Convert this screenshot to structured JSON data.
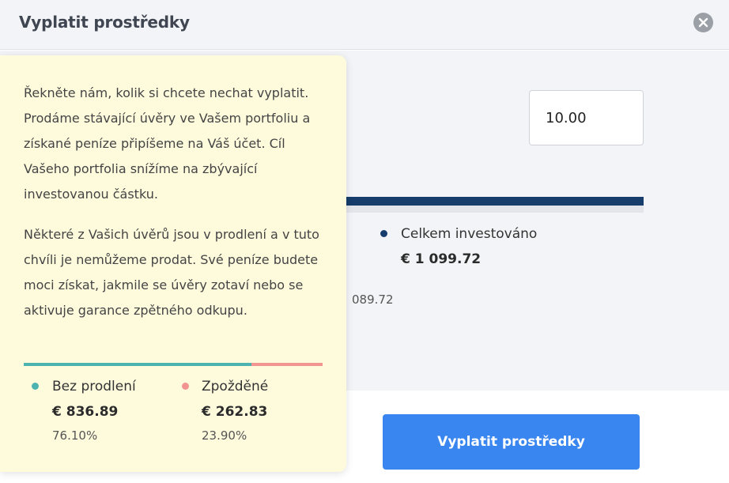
{
  "modal": {
    "title": "Vyplatit prostředky",
    "close_icon": "close-icon"
  },
  "amount_input": {
    "value": "10.00"
  },
  "portfolio": {
    "total_label": "Celkem investováno",
    "total_value": "€ 1 099.72",
    "partial_value": "089.72",
    "color_total": "#163d6b"
  },
  "tooltip": {
    "paragraph1": "Řekněte nám, kolik si chcete nechat vyplatit. Prodáme stávající úvěry ve Vašem portfoliu a získané peníze připíšeme na Váš účet. Cíl Vašeho portfolia snížíme na zbývající investovanou částku.",
    "paragraph2": "Některé z Vašich úvěrů jsou v prodlení a v tuto chvíli je nemůžeme prodat. Své peníze budete moci získat, jakmile se úvěry zotaví nebo se aktivuje garance zpětného odkupu.",
    "split": {
      "good_fraction": 0.761,
      "late_fraction": 0.239
    },
    "good": {
      "label": "Bez prodlení",
      "value": "€ 836.89",
      "percent": "76.10%",
      "color": "#4cb3b0"
    },
    "late": {
      "label": "Zpožděné",
      "value": "€ 262.83",
      "percent": "23.90%",
      "color": "#f2948f"
    }
  },
  "submit_button": {
    "label": "Vyplatit prostředky",
    "color": "#3a86f0"
  }
}
